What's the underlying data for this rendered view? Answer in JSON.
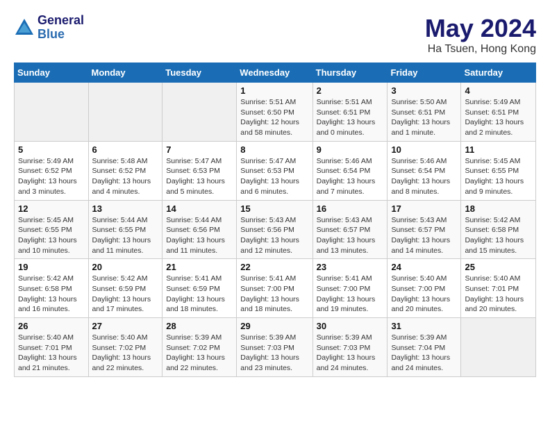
{
  "header": {
    "logo_line1": "General",
    "logo_line2": "Blue",
    "title": "May 2024",
    "subtitle": "Ha Tsuen, Hong Kong"
  },
  "columns": [
    "Sunday",
    "Monday",
    "Tuesday",
    "Wednesday",
    "Thursday",
    "Friday",
    "Saturday"
  ],
  "weeks": [
    [
      {
        "day": "",
        "empty": true
      },
      {
        "day": "",
        "empty": true
      },
      {
        "day": "",
        "empty": true
      },
      {
        "day": "1",
        "sunrise": "5:51 AM",
        "sunset": "6:50 PM",
        "daylight": "12 hours and 58 minutes."
      },
      {
        "day": "2",
        "sunrise": "5:51 AM",
        "sunset": "6:51 PM",
        "daylight": "13 hours and 0 minutes."
      },
      {
        "day": "3",
        "sunrise": "5:50 AM",
        "sunset": "6:51 PM",
        "daylight": "13 hours and 1 minute."
      },
      {
        "day": "4",
        "sunrise": "5:49 AM",
        "sunset": "6:51 PM",
        "daylight": "13 hours and 2 minutes."
      }
    ],
    [
      {
        "day": "5",
        "sunrise": "5:49 AM",
        "sunset": "6:52 PM",
        "daylight": "13 hours and 3 minutes."
      },
      {
        "day": "6",
        "sunrise": "5:48 AM",
        "sunset": "6:52 PM",
        "daylight": "13 hours and 4 minutes."
      },
      {
        "day": "7",
        "sunrise": "5:47 AM",
        "sunset": "6:53 PM",
        "daylight": "13 hours and 5 minutes."
      },
      {
        "day": "8",
        "sunrise": "5:47 AM",
        "sunset": "6:53 PM",
        "daylight": "13 hours and 6 minutes."
      },
      {
        "day": "9",
        "sunrise": "5:46 AM",
        "sunset": "6:54 PM",
        "daylight": "13 hours and 7 minutes."
      },
      {
        "day": "10",
        "sunrise": "5:46 AM",
        "sunset": "6:54 PM",
        "daylight": "13 hours and 8 minutes."
      },
      {
        "day": "11",
        "sunrise": "5:45 AM",
        "sunset": "6:55 PM",
        "daylight": "13 hours and 9 minutes."
      }
    ],
    [
      {
        "day": "12",
        "sunrise": "5:45 AM",
        "sunset": "6:55 PM",
        "daylight": "13 hours and 10 minutes."
      },
      {
        "day": "13",
        "sunrise": "5:44 AM",
        "sunset": "6:55 PM",
        "daylight": "13 hours and 11 minutes."
      },
      {
        "day": "14",
        "sunrise": "5:44 AM",
        "sunset": "6:56 PM",
        "daylight": "13 hours and 11 minutes."
      },
      {
        "day": "15",
        "sunrise": "5:43 AM",
        "sunset": "6:56 PM",
        "daylight": "13 hours and 12 minutes."
      },
      {
        "day": "16",
        "sunrise": "5:43 AM",
        "sunset": "6:57 PM",
        "daylight": "13 hours and 13 minutes."
      },
      {
        "day": "17",
        "sunrise": "5:43 AM",
        "sunset": "6:57 PM",
        "daylight": "13 hours and 14 minutes."
      },
      {
        "day": "18",
        "sunrise": "5:42 AM",
        "sunset": "6:58 PM",
        "daylight": "13 hours and 15 minutes."
      }
    ],
    [
      {
        "day": "19",
        "sunrise": "5:42 AM",
        "sunset": "6:58 PM",
        "daylight": "13 hours and 16 minutes."
      },
      {
        "day": "20",
        "sunrise": "5:42 AM",
        "sunset": "6:59 PM",
        "daylight": "13 hours and 17 minutes."
      },
      {
        "day": "21",
        "sunrise": "5:41 AM",
        "sunset": "6:59 PM",
        "daylight": "13 hours and 18 minutes."
      },
      {
        "day": "22",
        "sunrise": "5:41 AM",
        "sunset": "7:00 PM",
        "daylight": "13 hours and 18 minutes."
      },
      {
        "day": "23",
        "sunrise": "5:41 AM",
        "sunset": "7:00 PM",
        "daylight": "13 hours and 19 minutes."
      },
      {
        "day": "24",
        "sunrise": "5:40 AM",
        "sunset": "7:00 PM",
        "daylight": "13 hours and 20 minutes."
      },
      {
        "day": "25",
        "sunrise": "5:40 AM",
        "sunset": "7:01 PM",
        "daylight": "13 hours and 20 minutes."
      }
    ],
    [
      {
        "day": "26",
        "sunrise": "5:40 AM",
        "sunset": "7:01 PM",
        "daylight": "13 hours and 21 minutes."
      },
      {
        "day": "27",
        "sunrise": "5:40 AM",
        "sunset": "7:02 PM",
        "daylight": "13 hours and 22 minutes."
      },
      {
        "day": "28",
        "sunrise": "5:39 AM",
        "sunset": "7:02 PM",
        "daylight": "13 hours and 22 minutes."
      },
      {
        "day": "29",
        "sunrise": "5:39 AM",
        "sunset": "7:03 PM",
        "daylight": "13 hours and 23 minutes."
      },
      {
        "day": "30",
        "sunrise": "5:39 AM",
        "sunset": "7:03 PM",
        "daylight": "13 hours and 24 minutes."
      },
      {
        "day": "31",
        "sunrise": "5:39 AM",
        "sunset": "7:04 PM",
        "daylight": "13 hours and 24 minutes."
      },
      {
        "day": "",
        "empty": true
      }
    ]
  ]
}
